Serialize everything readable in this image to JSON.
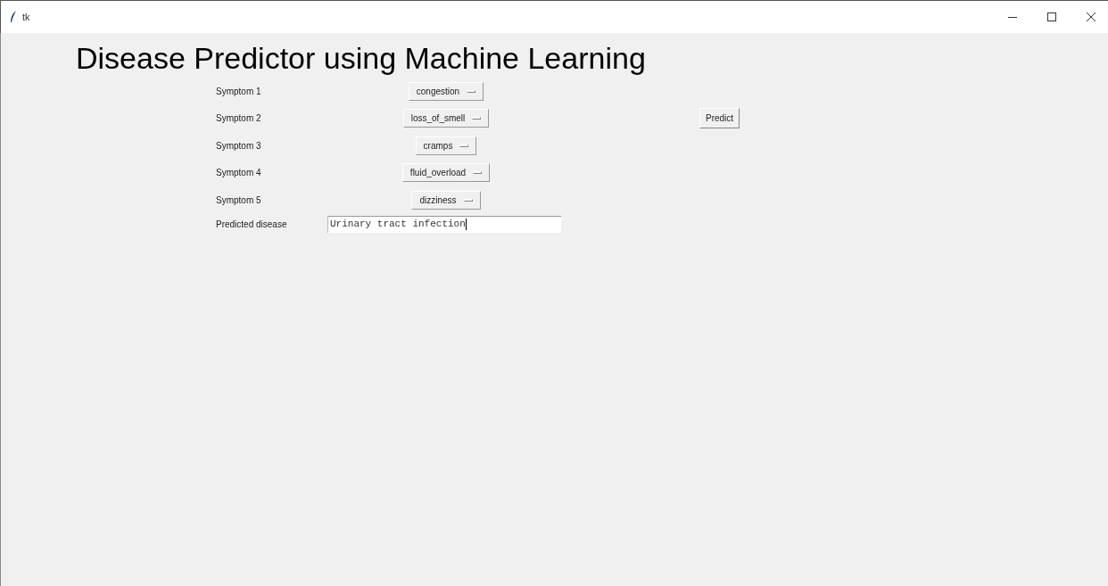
{
  "window": {
    "title": "tk"
  },
  "heading": "Disease Predictor using Machine Learning",
  "symptoms": [
    {
      "label": "Symptom 1",
      "value": "congestion"
    },
    {
      "label": "Symptom 2",
      "value": "loss_of_smell"
    },
    {
      "label": "Symptom 3",
      "value": "cramps"
    },
    {
      "label": "Symptom 4",
      "value": "fluid_overload"
    },
    {
      "label": "Symptom 5",
      "value": "dizziness"
    }
  ],
  "predict_button": "Predict",
  "result": {
    "label": "Predicted disease",
    "value": "Urinary tract infection"
  }
}
